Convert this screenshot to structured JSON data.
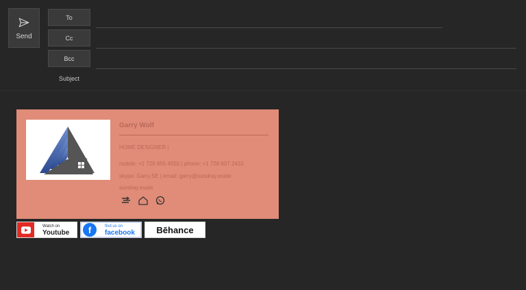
{
  "compose": {
    "send_label": "Send",
    "to_label": "To",
    "cc_label": "Cc",
    "bcc_label": "Bcc",
    "subject_label": "Subject"
  },
  "signature": {
    "name": "Garry Wolf",
    "title": "HOME DESIGNER |",
    "phones": "mobile: +1 729 855 4555 | phone: +1 728 607 2433",
    "skype_email": "skype: Garry.SE | email: garry@sundray.esate",
    "website": "sundray.esate",
    "icons": [
      "sketch-icon",
      "house-icon",
      "whatsapp-icon"
    ],
    "accent_color": "#e08c78",
    "text_color": "#b9685a"
  },
  "badges": {
    "youtube_top": "Watch on",
    "youtube_main": "Youtube",
    "facebook_top": "find us on",
    "facebook_main": "facebook",
    "behance": "Bēhance"
  }
}
